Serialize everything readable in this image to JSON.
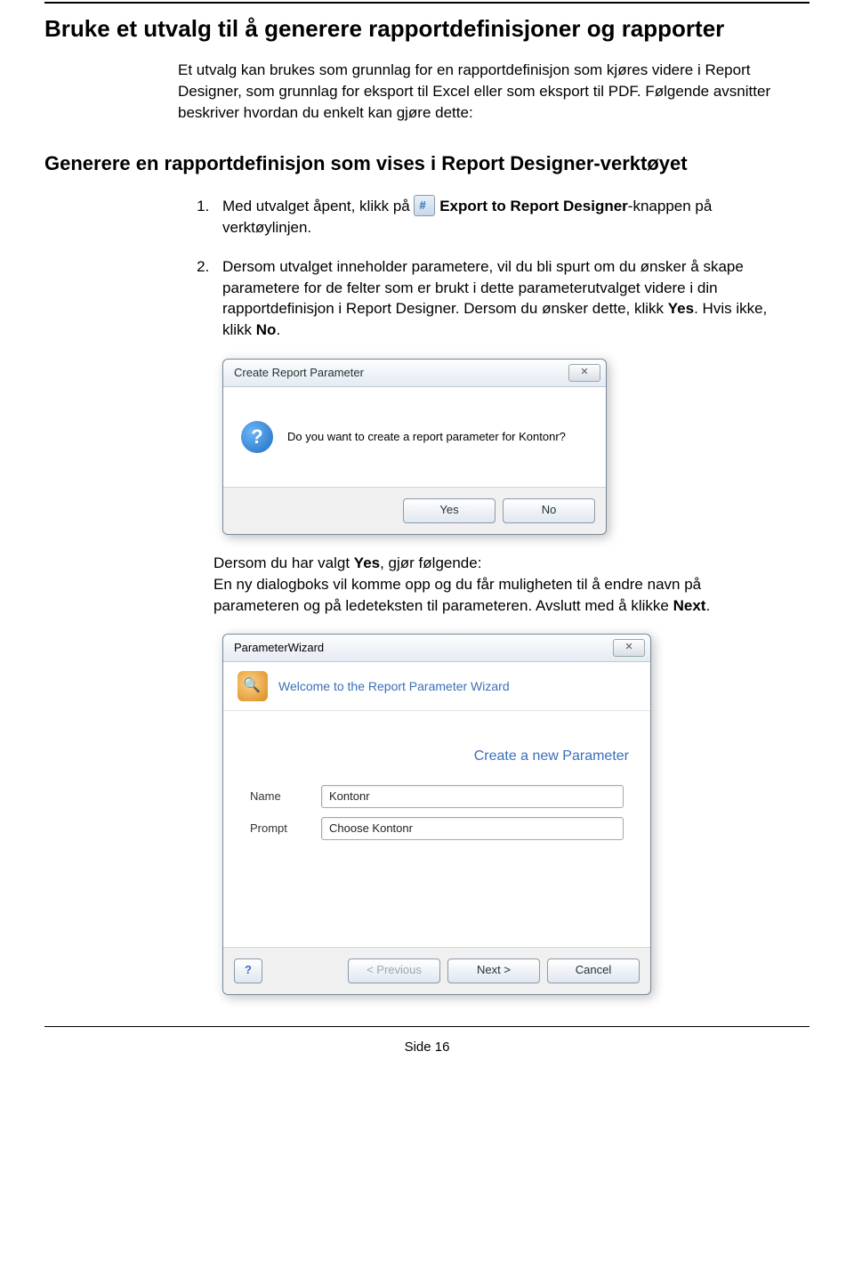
{
  "heading1": "Bruke et utvalg til å generere rapportdefinisjoner og rapporter",
  "intro": "Et utvalg kan brukes som grunnlag for en rapportdefinisjon som kjøres videre i Report Designer, som grunnlag for eksport til Excel eller som eksport til PDF. Følgende avsnitter beskriver hvordan du enkelt kan gjøre dette:",
  "heading2": "Generere en rapportdefinisjon som vises i Report Designer-verktøyet",
  "step1": {
    "pre": "Med utvalget åpent, klikk på",
    "bold": "Export to Report Designer",
    "post": "-knappen på verktøylinjen."
  },
  "step2": {
    "text1": "Dersom utvalget inneholder parametere, vil du bli spurt om du ønsker å skape parametere for de felter som er brukt i dette parameterutvalget videre i din rapportdefinisjon i Report Designer. Dersom du ønsker dette, klikk ",
    "yes": "Yes",
    "text2": ". Hvis ikke, klikk ",
    "no": "No",
    "text3": "."
  },
  "dialog1": {
    "title": "Create Report Parameter",
    "close": "✕",
    "question": "Do you want to create a report parameter for Kontonr?",
    "yes": "Yes",
    "no": "No"
  },
  "after": {
    "line1a": "Dersom du har valgt ",
    "yesb": "Yes",
    "line1b": ", gjør følgende:",
    "line2a": "En ny dialogboks vil komme opp og du får muligheten til å endre navn på parameteren og på ledeteksten til parameteren. Avslutt med å klikke ",
    "nextb": "Next",
    "line2b": "."
  },
  "wizard": {
    "title": "ParameterWizard",
    "close": "✕",
    "welcome": "Welcome to the Report Parameter Wizard",
    "subtitle": "Create a new Parameter",
    "name_label": "Name",
    "name_value": "Kontonr",
    "prompt_label": "Prompt",
    "prompt_value": "Choose Kontonr",
    "help": "?",
    "prev": "< Previous",
    "next": "Next >",
    "cancel": "Cancel"
  },
  "pagefoot": "Side 16"
}
